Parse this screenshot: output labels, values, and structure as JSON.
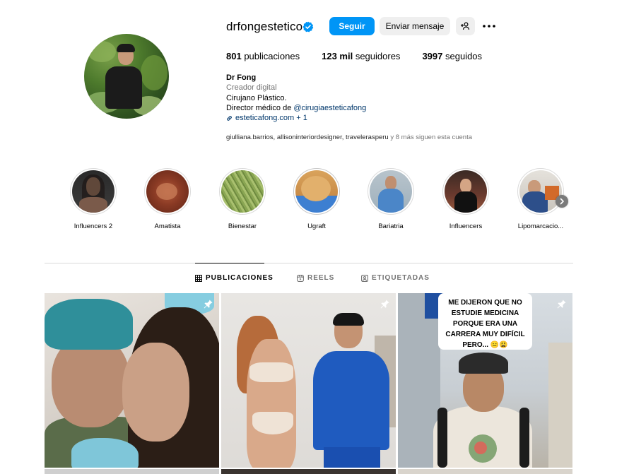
{
  "profile": {
    "username": "drfongestetico",
    "follow_label": "Seguir",
    "message_label": "Enviar mensaje",
    "stats": {
      "posts_count": "801",
      "posts_label": "publicaciones",
      "followers_count": "123 mil",
      "followers_label": "seguidores",
      "following_count": "3997",
      "following_label": "seguidos"
    },
    "full_name": "Dr Fong",
    "category": "Creador digital",
    "bio_line1": "Cirujano Plástico.",
    "bio_line2_prefix": "Director médico de ",
    "bio_line2_mention": "@cirugiaesteticafong",
    "link_text": "esteticafong.com + 1",
    "followed_by_names": "giulliana.barrios, allisoninteriordesigner, travelerasperu",
    "followed_by_suffix": " y 8 más siguen esta cuenta"
  },
  "highlights": [
    {
      "label": "Influencers 2"
    },
    {
      "label": "Amatista"
    },
    {
      "label": "Bienestar"
    },
    {
      "label": "Ugraft"
    },
    {
      "label": "Bariatria"
    },
    {
      "label": "Influencers"
    },
    {
      "label": "Lipomarcacio..."
    }
  ],
  "tabs": [
    {
      "label": "PUBLICACIONES",
      "active": true
    },
    {
      "label": "REELS",
      "active": false
    },
    {
      "label": "ETIQUETADAS",
      "active": false
    }
  ],
  "posts": [
    {
      "pinned": true
    },
    {
      "pinned": true
    },
    {
      "pinned": true,
      "caption": [
        "ME DIJERON QUE NO",
        "ESTUDIE MEDICINA",
        "PORQUE ERA UNA",
        "CARRERA MUY DIFÍCIL",
        "PERO... 😑😩"
      ]
    }
  ],
  "colors": {
    "primary_button": "#0095f6",
    "secondary_button": "#efefef",
    "link": "#00376b",
    "muted_text": "#737373",
    "verified_badge": "#0095f6"
  },
  "icons": [
    "verified-badge-icon",
    "add-user-icon",
    "more-options-icon",
    "link-icon",
    "chevron-right-icon",
    "grid-icon",
    "reels-icon",
    "tagged-icon",
    "pin-icon"
  ]
}
